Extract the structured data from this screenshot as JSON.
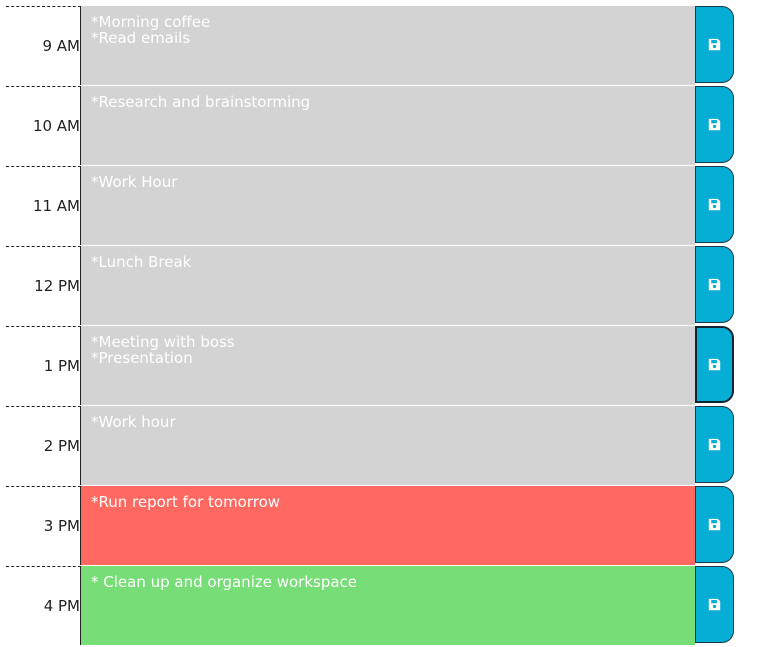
{
  "planner": {
    "rows": [
      {
        "hour": "9 AM",
        "text": "*Morning coffee\n*Read emails",
        "state": "past"
      },
      {
        "hour": "10 AM",
        "text": "*Research and brainstorming",
        "state": "past"
      },
      {
        "hour": "11 AM",
        "text": "*Work Hour",
        "state": "past"
      },
      {
        "hour": "12 PM",
        "text": "*Lunch Break",
        "state": "past"
      },
      {
        "hour": "1 PM",
        "text": "*Meeting with boss\n*Presentation",
        "state": "past"
      },
      {
        "hour": "2 PM",
        "text": "*Work hour",
        "state": "past"
      },
      {
        "hour": "3 PM",
        "text": "*Run report for tomorrow",
        "state": "present"
      },
      {
        "hour": "4 PM",
        "text": "* Clean up and organize workspace",
        "state": "future"
      }
    ],
    "save_icon": "floppy-disk-icon",
    "colors": {
      "past": "#d3d3d3",
      "present": "#ff6961",
      "future": "#77dd77",
      "save_button": "#06aed5"
    }
  }
}
